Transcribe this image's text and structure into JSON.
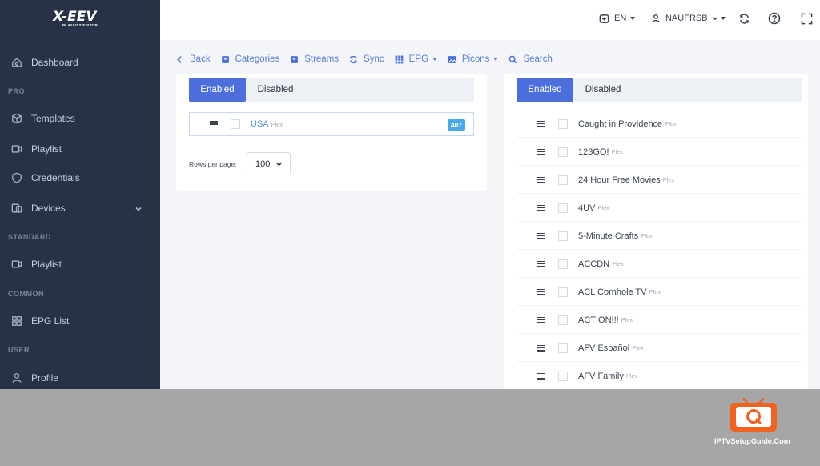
{
  "sidebar": {
    "logo": {
      "main": "X-EEV",
      "sub": "PLAYLIST EDITOR"
    },
    "items": [
      {
        "label": "Dashboard",
        "icon": "home-icon"
      },
      {
        "label": "Templates",
        "icon": "box-icon"
      },
      {
        "label": "Playlist",
        "icon": "video-icon"
      },
      {
        "label": "Credentials",
        "icon": "shield-icon"
      },
      {
        "label": "Devices",
        "icon": "devices-icon"
      },
      {
        "label": "Playlist",
        "icon": "video-icon"
      },
      {
        "label": "EPG List",
        "icon": "grid-icon"
      },
      {
        "label": "Profile",
        "icon": "user-icon"
      }
    ],
    "sections": {
      "pro": "PRO",
      "standard": "STANDARD",
      "common": "COMMON",
      "user": "USER"
    }
  },
  "topbar": {
    "language": "EN",
    "username": "NAUFRSB"
  },
  "toolbar": {
    "back": "Back",
    "categories": "Categories",
    "streams": "Streams",
    "sync": "Sync",
    "epg": "EPG",
    "picons": "Picons",
    "search": "Search"
  },
  "left_panel": {
    "tabs": {
      "enabled": "Enabled",
      "disabled": "Disabled"
    },
    "row": {
      "name": "USA",
      "tag": "Plex",
      "count": "407"
    },
    "rows_per_page_label": "Rows per page:",
    "rows_per_page_value": "100"
  },
  "right_panel": {
    "tabs": {
      "enabled": "Enabled",
      "disabled": "Disabled"
    },
    "channels": [
      {
        "name": "Caught in Providence",
        "tag": "Plex"
      },
      {
        "name": "123GO!",
        "tag": "Plex"
      },
      {
        "name": "24 Hour Free Movies",
        "tag": "Plex"
      },
      {
        "name": "4UV",
        "tag": "Plex"
      },
      {
        "name": "5-Minute Crafts",
        "tag": "Plex"
      },
      {
        "name": "ACCDN",
        "tag": "Plex"
      },
      {
        "name": "ACL Cornhole TV",
        "tag": "Plex"
      },
      {
        "name": "ACTION!!!",
        "tag": "Plex"
      },
      {
        "name": "AFV Español",
        "tag": "Plex"
      },
      {
        "name": "AFV Family",
        "tag": "Plex"
      }
    ]
  },
  "watermark": {
    "text": "IPTVSetupGuide.Com"
  },
  "colors": {
    "sidebar_bg": "#273248",
    "accent": "#4d6fde",
    "link": "#5a7fd6",
    "badge": "#4aa8e8",
    "watermark_orange": "#f0621f"
  }
}
